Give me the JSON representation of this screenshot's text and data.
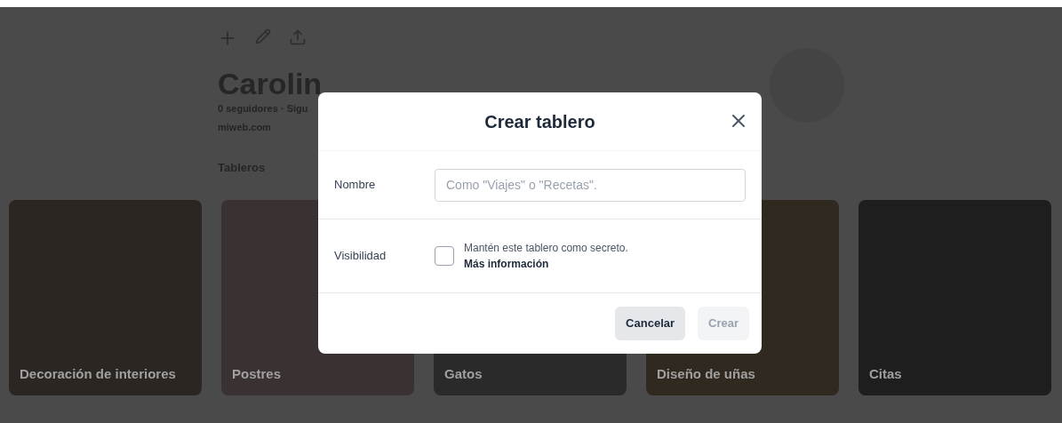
{
  "profile": {
    "name": "Carolin",
    "stats": "0 seguidores · Sigu",
    "website": "miweb.com",
    "tabs": [
      {
        "label": "Tableros",
        "selected": true
      }
    ]
  },
  "boards": [
    {
      "title": "Decoración de interiores",
      "color": "#2b2622"
    },
    {
      "title": "Postres",
      "color": "#3a3232"
    },
    {
      "title": "Gatos",
      "color": "#2a2a2a"
    },
    {
      "title": "Diseño de uñas",
      "color": "#30291f"
    },
    {
      "title": "Citas",
      "color": "#1e1e1e"
    }
  ],
  "dialog": {
    "title": "Crear tablero",
    "name_label": "Nombre",
    "name_placeholder": "Como \"Viajes\" o \"Recetas\".",
    "visibility_label": "Visibilidad",
    "secret": {
      "text": "Mantén este tablero como secreto.",
      "link": "Más información",
      "checked": false
    },
    "buttons": [
      {
        "label": "Cancelar",
        "disabled": false
      },
      {
        "label": "Crear",
        "disabled": true
      }
    ]
  }
}
